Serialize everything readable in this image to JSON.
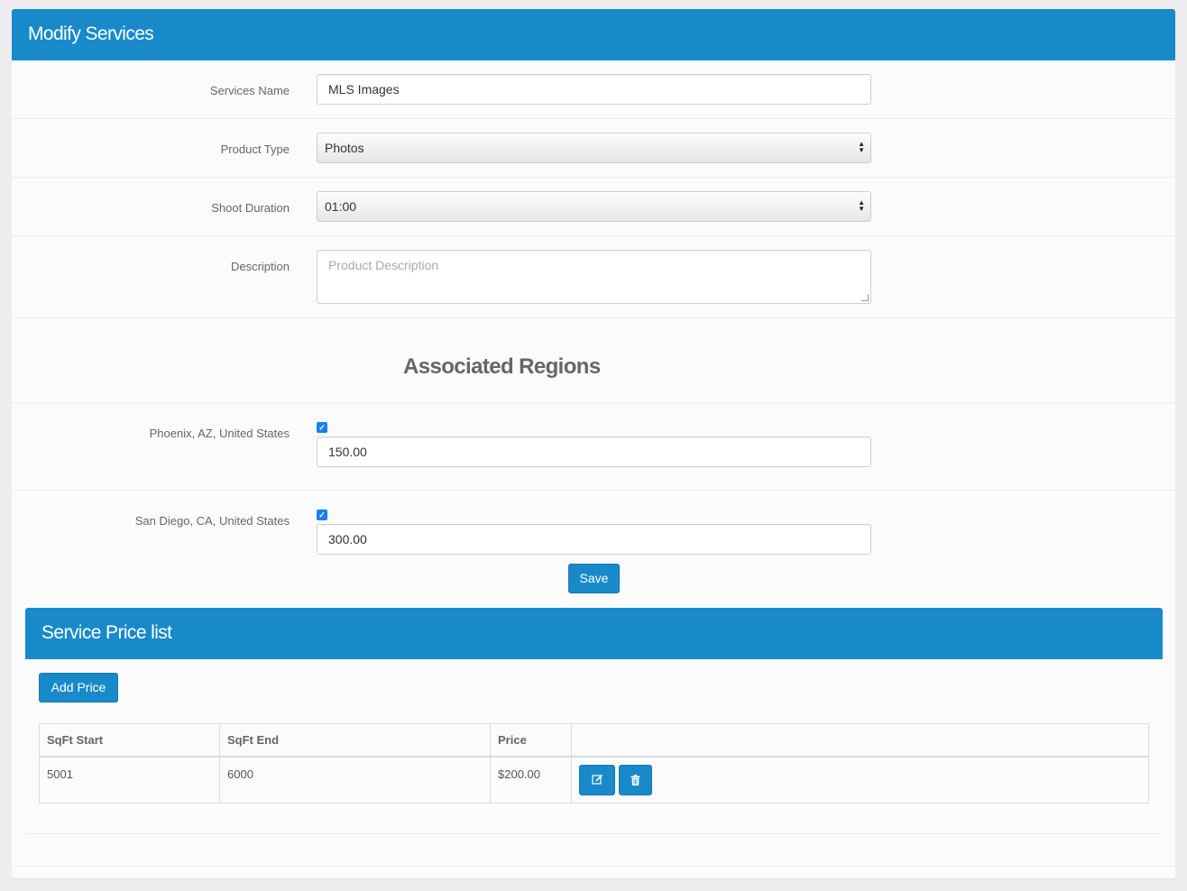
{
  "header": {
    "title": "Modify Services"
  },
  "form": {
    "service_name": {
      "label": "Services Name",
      "value": "MLS Images"
    },
    "product_type": {
      "label": "Product Type",
      "value": "Photos"
    },
    "shoot_duration": {
      "label": "Shoot Duration",
      "value": "01:00"
    },
    "description": {
      "label": "Description",
      "placeholder": "Product Description",
      "value": ""
    }
  },
  "regions": {
    "heading": "Associated Regions",
    "items": [
      {
        "label": "Phoenix, AZ, United States",
        "checked": true,
        "price": "150.00"
      },
      {
        "label": "San Diego, CA, United States",
        "checked": true,
        "price": "300.00"
      }
    ]
  },
  "save_label": "Save",
  "price_list": {
    "title": "Service Price list",
    "add_label": "Add Price",
    "columns": [
      "SqFt Start",
      "SqFt End",
      "Price",
      ""
    ],
    "rows": [
      {
        "start": "5001",
        "end": "6000",
        "price": "$200.00"
      }
    ]
  },
  "icons": {
    "edit": "edit-icon",
    "delete": "trash-icon",
    "check": "checkmark-icon"
  },
  "colors": {
    "primary": "#188aca",
    "checkbox": "#1a7ff2"
  }
}
